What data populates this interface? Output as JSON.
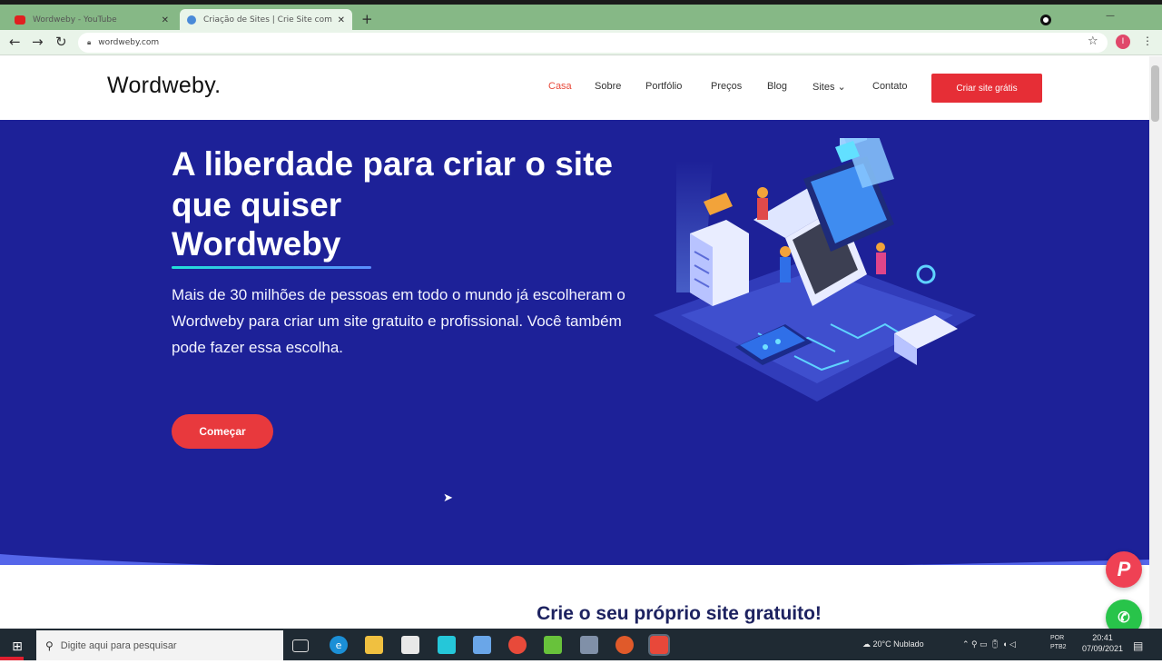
{
  "browser": {
    "tabs": [
      {
        "title": "Wordweby - YouTube",
        "favicon_color": "#e02020",
        "active": false
      },
      {
        "title": "Criação de Sites | Crie Site com",
        "favicon_color": "#4a8ad8",
        "active": true
      }
    ],
    "new_tab_label": "+",
    "url": "wordweby.com",
    "avatar_letter": "I"
  },
  "site": {
    "logo": "Wordweby.",
    "nav": [
      {
        "label": "Casa",
        "active": true
      },
      {
        "label": "Sobre"
      },
      {
        "label": "Portfólio"
      },
      {
        "label": "Preços"
      },
      {
        "label": "Blog"
      },
      {
        "label": "Sites ⌄"
      },
      {
        "label": "Contato"
      }
    ],
    "cta": "Criar site grátis",
    "hero": {
      "title": "A liberdade para criar o site que quiser",
      "brand": "Wordweby",
      "description": "Mais de 30 milhões de pessoas em todo o mundo já escolheram o Wordweby para criar um site gratuito e profissional. Você também pode fazer essa escolha.",
      "button": "Começar"
    },
    "section_title": "Crie o seu próprio site gratuito!",
    "colors": {
      "hero_bg": "#1d2198",
      "accent_red": "#e62e36",
      "heading_dark": "#1d2260"
    }
  },
  "taskbar": {
    "search_placeholder": "Digite aqui para pesquisar",
    "weather": "20°C Nublado",
    "tray_lang": "POR PTB2",
    "time": "20:41",
    "date": "07/09/2021"
  }
}
